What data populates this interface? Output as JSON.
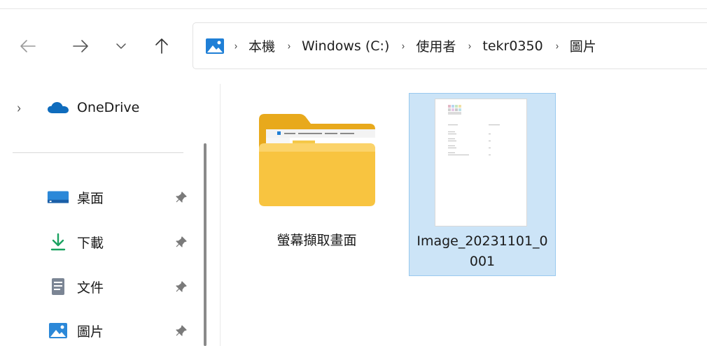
{
  "navigation": {
    "back_icon": "arrow-left-icon",
    "forward_icon": "arrow-right-icon",
    "recent_icon": "chevron-down-icon",
    "up_icon": "arrow-up-icon"
  },
  "address_bar": {
    "root_icon": "pictures-folder-icon",
    "separator": "›",
    "crumbs": [
      "本機",
      "Windows (C:)",
      "使用者",
      "tekr0350",
      "圖片"
    ]
  },
  "sidebar": {
    "onedrive": {
      "label": "OneDrive",
      "expand_glyph": "›",
      "icon": "cloud-icon"
    },
    "quick_access": [
      {
        "label": "桌面",
        "icon": "desktop-icon",
        "pinned": true
      },
      {
        "label": "下載",
        "icon": "download-icon",
        "pinned": true
      },
      {
        "label": "文件",
        "icon": "document-icon",
        "pinned": true
      },
      {
        "label": "圖片",
        "icon": "pictures-icon",
        "pinned": true
      }
    ]
  },
  "content": {
    "items": [
      {
        "name": "螢幕擷取畫面",
        "type": "folder",
        "selected": false
      },
      {
        "name": "Image_20231101_0001",
        "type": "image",
        "selected": true
      }
    ]
  },
  "colors": {
    "selection_fill": "#cce4f7",
    "selection_border": "#99c9ef",
    "folder_yellow": "#f8c440",
    "onedrive_blue": "#0f6cbd",
    "download_green": "#1aa260",
    "pictures_blue": "#2b88d8"
  }
}
